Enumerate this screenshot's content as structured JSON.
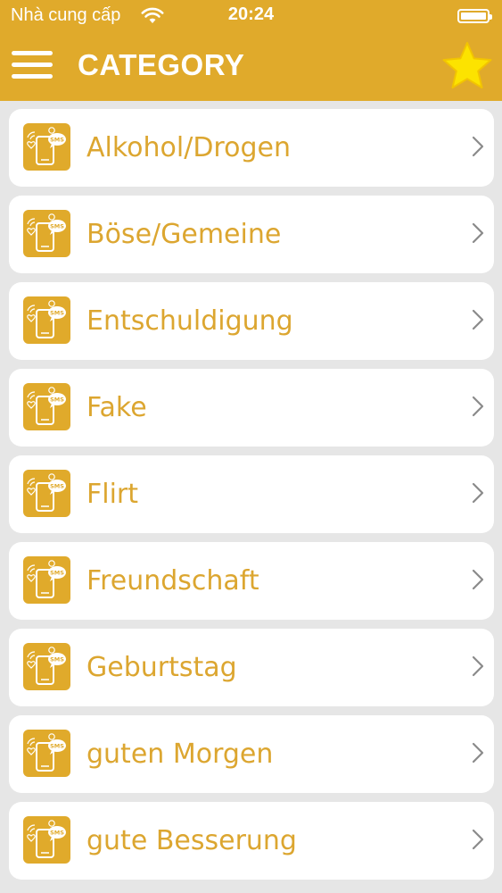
{
  "status_bar": {
    "carrier": "Nhà cung cấp",
    "time": "20:24",
    "wifi_icon": "wifi-icon",
    "battery_icon": "battery-icon"
  },
  "header": {
    "title": "CATEGORY",
    "menu_icon": "hamburger-menu-icon",
    "favorite_icon": "star-icon",
    "bar_color": "#e0aa2b",
    "star_color": "#fce300"
  },
  "categories": [
    {
      "label": "Alkohol/Drogen"
    },
    {
      "label": "Böse/Gemeine"
    },
    {
      "label": "Entschuldigung"
    },
    {
      "label": "Fake"
    },
    {
      "label": "Flirt"
    },
    {
      "label": "Freundschaft"
    },
    {
      "label": "Geburtstag"
    },
    {
      "label": "guten Morgen"
    },
    {
      "label": "gute Besserung"
    }
  ],
  "list_style": {
    "text_color": "#dca630",
    "icon_name": "sms-phone-app-icon",
    "chevron_icon": "chevron-right-icon",
    "icon_badge_text": "SMS"
  }
}
